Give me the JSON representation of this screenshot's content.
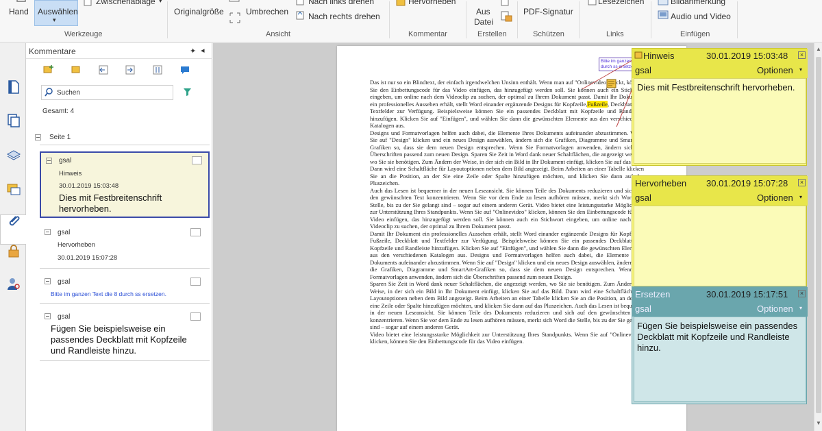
{
  "ribbon": {
    "hand_label": "Hand",
    "select_label": "Auswählen",
    "clipboard_label": "Zwischenablage",
    "group_tools": "Werkzeuge",
    "actual_size_label": "Originalgröße",
    "wrap_label": "Umbrechen",
    "rotate_left_label": "Nach links drehen",
    "rotate_right_label": "Nach rechts drehen",
    "group_view": "Ansicht",
    "highlight_label": "Hervorheben",
    "group_comments": "Kommentar",
    "from_file_line1": "Aus",
    "from_file_line2": "Datei",
    "group_create": "Erstellen",
    "pdf_signature_label": "PDF-Signatur",
    "group_protect": "Schützen",
    "bookmark_label": "Lesezeichen",
    "group_links": "Links",
    "image_annotation_label": "Bildanmerkung",
    "audio_video_label": "Audio und Video",
    "group_insert": "Einfügen"
  },
  "panel": {
    "title": "Kommentare",
    "search_placeholder": "Suchen",
    "total": "Gesamt: 4",
    "page_label": "Seite 1",
    "comments": [
      {
        "user": "gsal",
        "type": "Hinweis",
        "date": "30.01.2019 15:03:48",
        "text": "Dies mit Festbreitenschrift hervorheben."
      },
      {
        "user": "gsal",
        "type": "Hervorheben",
        "date": "30.01.2019 15:07:28",
        "text": ""
      },
      {
        "user": "gsal",
        "type": "",
        "date": "",
        "text": "Bitte im ganzen Text die 8 durch ss ersetzen."
      },
      {
        "user": "gsal",
        "type": "",
        "date": "",
        "text": "Fügen Sie beispielsweise ein passendes Deckblatt mit Kopfzeile und Randleiste hinzu."
      }
    ]
  },
  "notes": [
    {
      "type": "Hinweis",
      "date": "30.01.2019 15:03:48",
      "user": "gsal",
      "options": "Optionen",
      "text": "Dies mit Festbreitenschrift hervorheben."
    },
    {
      "type": "Hervorheben",
      "date": "30.01.2019 15:07:28",
      "user": "gsal",
      "options": "Optionen",
      "text": ""
    },
    {
      "type": "Ersetzen",
      "date": "30.01.2019 15:17:51",
      "user": "gsal",
      "options": "Optionen",
      "text": "Fügen Sie beispielsweise ein passendes Deckblatt mit Kopfzeile und Randleiste hinzu."
    }
  ],
  "document": {
    "popup_text": "Bitte im ganzen Text die 8 durch ss ersetzen",
    "para1_a": "Das ist nur so ein Blindtext, der einfach irgendwelchen Unsinn enthält. Wenn man auf \"Onlinevideo\" klickt, können Sie den Einbettungscode für das Video einfügen, das hinzugefügt werden soll. Sie können auch ein Stichwort eingeben, um online nach dem Videoclip zu suchen, der optimal zu Ihrem Dokument passt. Damit Ihr Dokument ein professionelles Aussehen erhält, stellt Word einander ergänzende Designs für Kopfzeile,",
    "para1_hl": "Fußzeile",
    "para1_b": ", Deckblatt und Textfelder zur Verfügung. Beispielsweise können Sie ein passendes Deckblatt mit Kopfzeile und Randleiste hinzufügen. Klicken Sie auf \"Einfügen\", und wählen Sie dann die gewünschten Elemente aus den verschiedenen Katalogen aus.",
    "para2": "Designs und Formatvorlagen helfen auch dabei, die Elemente Ihres Dokuments aufeinander abzustimmen. Wenn Sie auf \"Design\" klicken und ein neues Design auswählen, ändern sich die Grafiken, Diagramme und SmartArt-Grafiken so, dass sie dem neuen Design entsprechen. Wenn Sie Formatvorlagen anwenden, ändern sich die Überschriften passend zum neuen Design. Sparen Sie Zeit in Word dank neuer Schaltflächen, die angezeigt werden, wo Sie sie benötigen. Zum Ändern der Weise, in der sich ein Bild in Ihr Dokument einfügt, klicken Sie auf das Bild. Dann wird eine Schaltfläche für Layoutoptionen neben dem Bild angezeigt. Beim Arbeiten an einer Tabelle klicken Sie an die Position, an der Sie eine Zeile oder Spalte hinzufügen möchten, und klicken Sie dann auf das Pluszeichen.",
    "para3": "Auch das Lesen ist bequemer in der neuen Leseansicht. Sie können Teile des Dokuments reduzieren und sich auf den gewünschten Text konzentrieren. Wenn Sie vor dem Ende zu lesen aufhören müssen, merkt sich Word die Stelle, bis zu der Sie gelangt sind – sogar auf einem anderen Gerät. Video bietet eine leistungsstarke Möglichkeit zur Unterstützung Ihres Standpunkts. Wenn Sie auf \"Onlinevideo\" klicken, können Sie den Einbettungscode für das Video einfügen, das hinzugefügt werden soll. Sie können auch ein Stichwort eingeben, um online nach dem Videoclip zu suchen, der optimal zu Ihrem Dokument passt.",
    "para4": "Damit Ihr Dokument ein professionelles Aussehen erhält, stellt Word einander ergänzende Designs für Kopfzeile, Fußzeile, Deckblatt und Textfelder zur Verfügung. Beispielsweise können Sie ein passendes Deckblatt mit Kopfzeile und Randleiste hinzufügen. Klicken Sie auf \"Einfügen\", und wählen Sie dann die gewünschten Elemente aus den verschiedenen Katalogen aus. Designs und Formatvorlagen helfen auch dabei, die Elemente Ihres Dokuments aufeinander abzustimmen. Wenn Sie auf \"Design\" klicken und ein neues Design auswählen, ändern sich die Grafiken, Diagramme und SmartArt-Grafiken so, dass sie dem neuen Design entsprechen. Wenn Sie Formatvorlagen anwenden, ändern sich die Überschriften passend zum neuen Design.",
    "para5": "Sparen Sie Zeit in Word dank neuer Schaltflächen, die angezeigt werden, wo Sie sie benötigen. Zum Ändern der Weise, in der sich ein Bild in Ihr Dokument einfügt, klicken Sie auf das Bild. Dann wird eine Schaltfläche für Layoutoptionen neben dem Bild angezeigt. Beim Arbeiten an einer Tabelle klicken Sie an die Position, an der Sie eine Zeile oder Spalte hinzufügen möchten, und klicken Sie dann auf das Pluszeichen. Auch das Lesen ist bequemer in der neuen Leseansicht. Sie können Teile des Dokuments reduzieren und sich auf den gewünschten Text konzentrieren. Wenn Sie vor dem Ende zu lesen aufhören müssen, merkt sich Word die Stelle, bis zu der Sie gelangt sind – sogar auf einem anderen Gerät.",
    "para6": "Video bietet eine leistungsstarke Möglichkeit zur Unterstützung Ihres Standpunkts. Wenn Sie auf \"Onlinevideo\" klicken, können Sie den Einbettungscode für das Video einfügen."
  },
  "colors": {
    "note_yellow": "#f7f580",
    "note_yellow_head": "#e8e64a",
    "note_teal": "#bcd9dc",
    "note_teal_head": "#6aa6ad"
  }
}
